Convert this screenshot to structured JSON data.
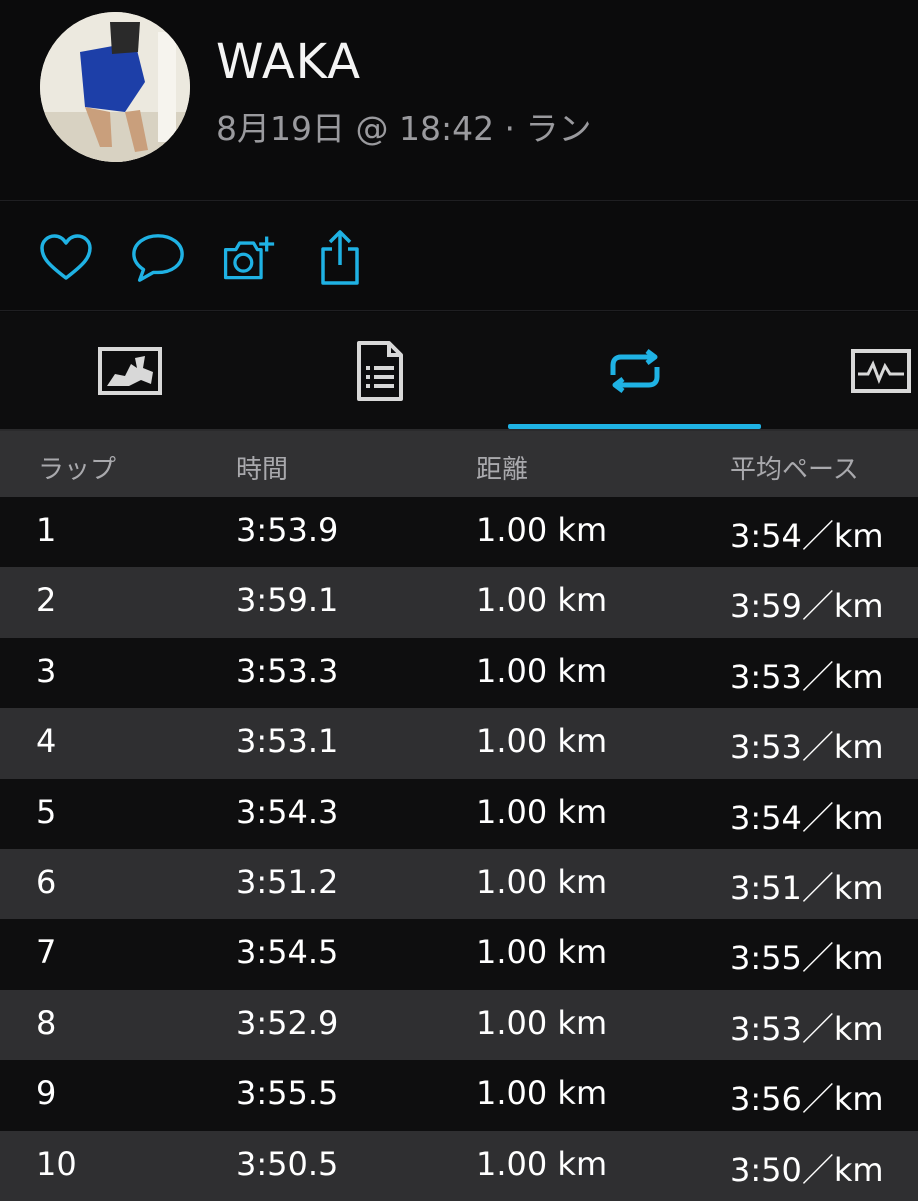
{
  "profile": {
    "name": "WAKA",
    "subtitle": "8月19日 @ 18:42 · ラン"
  },
  "actions": [
    {
      "name": "like",
      "icon": "heart-icon"
    },
    {
      "name": "comment",
      "icon": "comment-bubble-icon"
    },
    {
      "name": "add-photo",
      "icon": "camera-plus-icon"
    },
    {
      "name": "share",
      "icon": "share-icon"
    }
  ],
  "tabs": [
    {
      "name": "map",
      "icon": "map-icon",
      "active": false
    },
    {
      "name": "details",
      "icon": "document-list-icon",
      "active": false
    },
    {
      "name": "laps",
      "icon": "repeat-loop-icon",
      "active": true
    },
    {
      "name": "graphs",
      "icon": "activity-graph-icon",
      "active": false
    }
  ],
  "colors": {
    "accent": "#1fb2e4",
    "background": "#0a0a0b",
    "row_alt": "#2f2f31",
    "header_bg": "#313133"
  },
  "table": {
    "headers": {
      "lap": "ラップ",
      "time": "時間",
      "distance": "距離",
      "pace": "平均ペース"
    },
    "rows": [
      {
        "lap": "1",
        "time": "3:53.9",
        "distance": "1.00 km",
        "pace": "3:54／km"
      },
      {
        "lap": "2",
        "time": "3:59.1",
        "distance": "1.00 km",
        "pace": "3:59／km"
      },
      {
        "lap": "3",
        "time": "3:53.3",
        "distance": "1.00 km",
        "pace": "3:53／km"
      },
      {
        "lap": "4",
        "time": "3:53.1",
        "distance": "1.00 km",
        "pace": "3:53／km"
      },
      {
        "lap": "5",
        "time": "3:54.3",
        "distance": "1.00 km",
        "pace": "3:54／km"
      },
      {
        "lap": "6",
        "time": "3:51.2",
        "distance": "1.00 km",
        "pace": "3:51／km"
      },
      {
        "lap": "7",
        "time": "3:54.5",
        "distance": "1.00 km",
        "pace": "3:55／km"
      },
      {
        "lap": "8",
        "time": "3:52.9",
        "distance": "1.00 km",
        "pace": "3:53／km"
      },
      {
        "lap": "9",
        "time": "3:55.5",
        "distance": "1.00 km",
        "pace": "3:56／km"
      },
      {
        "lap": "10",
        "time": "3:50.5",
        "distance": "1.00 km",
        "pace": "3:50／km"
      }
    ]
  }
}
